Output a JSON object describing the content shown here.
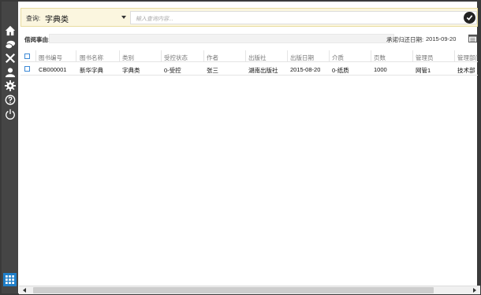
{
  "search": {
    "label": "查询:",
    "category": "字典类",
    "placeholder": "输入查询内容..."
  },
  "form": {
    "reason_label": "借阅事由:",
    "reason_value": "",
    "due_label": "承诺归还日期:",
    "due_value": "2015-09-20"
  },
  "table": {
    "headers": [
      "图书编号",
      "图书名称",
      "类别",
      "受控状态",
      "作者",
      "出版社",
      "出版日期",
      "介质",
      "页数",
      "管理员",
      "管理部门"
    ],
    "rows": [
      [
        "CB000001",
        "新华字典",
        "字典类",
        "0-受控",
        "张三",
        "湖南出版社",
        "2015-08-20",
        "0-纸质",
        "1000",
        "网管1",
        "技术部"
      ]
    ]
  },
  "sidebar": {
    "icons": [
      "home-icon",
      "chat-icon",
      "tools-icon",
      "user-icon",
      "gear-icon",
      "help-icon",
      "power-icon",
      "grid-icon"
    ]
  },
  "colors": {
    "sidebar": "#454545",
    "search_bg": "#fbf6df",
    "accent": "#1f7fc9",
    "checkbox": "#3d8ad6"
  }
}
